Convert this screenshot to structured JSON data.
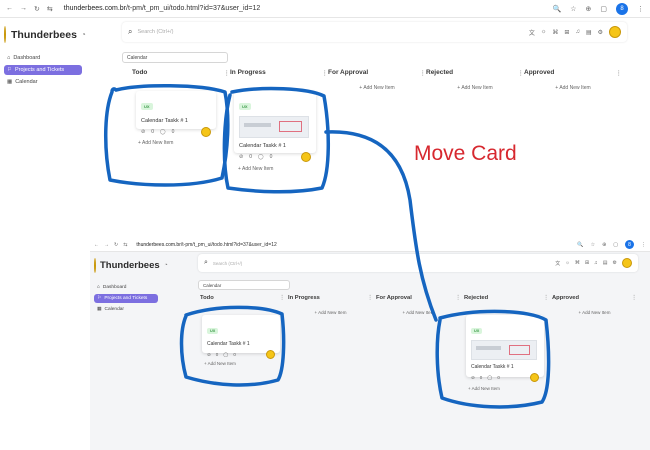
{
  "browser": {
    "url_host": "thunderbees.com.br",
    "url_path": "/t-pm/t_pm_ui/todo.html?id=37&user_id=12",
    "profile_initial": "8"
  },
  "app": {
    "brand": "Thunderbees",
    "sidebar": [
      {
        "label": "Dashboard",
        "icon": "home-icon"
      },
      {
        "label": "Projects and Tickets",
        "icon": "tickets-icon",
        "active": true
      },
      {
        "label": "Calendar",
        "icon": "calendar-icon"
      }
    ],
    "search_placeholder": "Search (Ctrl+/)",
    "filter_value": "Calendar",
    "add_item_label": "+ Add New Item"
  },
  "columns": [
    {
      "title": "Todo"
    },
    {
      "title": "In Progress"
    },
    {
      "title": "For Approval"
    },
    {
      "title": "Rejected"
    },
    {
      "title": "Approved"
    }
  ],
  "card": {
    "tag": "UX",
    "title": "Calendar Taskk # 1",
    "attachments": "0",
    "comments": "0"
  },
  "annotation": {
    "label": "Move Card",
    "color": "#d7282f",
    "highlight_color": "#1565c0"
  },
  "colors": {
    "accent": "#7c6fe0",
    "tag_bg": "#d9f5dc",
    "tag_text": "#3a9a47"
  }
}
